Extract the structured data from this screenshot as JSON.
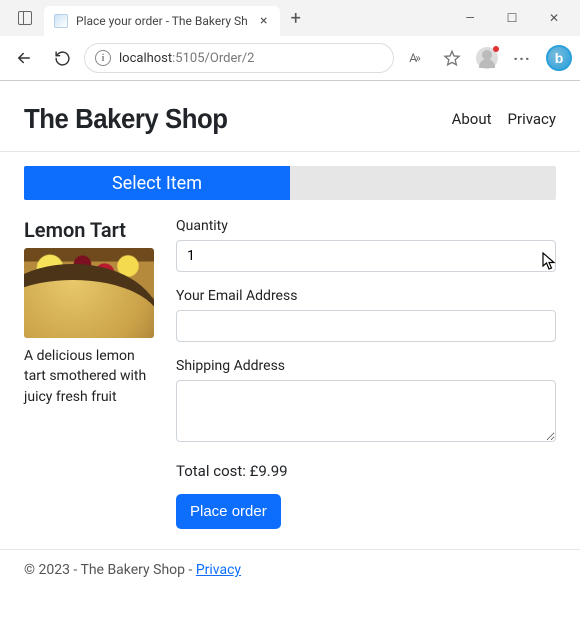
{
  "window": {
    "tab_title": "Place your order - The Bakery Sh"
  },
  "address_bar": {
    "host": "localhost",
    "port": ":5105",
    "path": "/Order/2",
    "reader_label": "A»"
  },
  "header": {
    "brand": "The Bakery Shop",
    "nav": {
      "about": "About",
      "privacy": "Privacy"
    }
  },
  "progress": {
    "step1": "Select Item"
  },
  "item": {
    "title": "Lemon Tart",
    "description": "A delicious lemon tart smothered with juicy fresh fruit"
  },
  "form": {
    "quantity_label": "Quantity",
    "quantity_value": "1",
    "email_label": "Your Email Address",
    "email_value": "",
    "shipping_label": "Shipping Address",
    "shipping_value": "",
    "total_label": "Total cost: ",
    "total_value": "£9.99",
    "submit_label": "Place order"
  },
  "footer": {
    "copyright": "© 2023 - The Bakery Shop - ",
    "privacy_link": "Privacy"
  }
}
